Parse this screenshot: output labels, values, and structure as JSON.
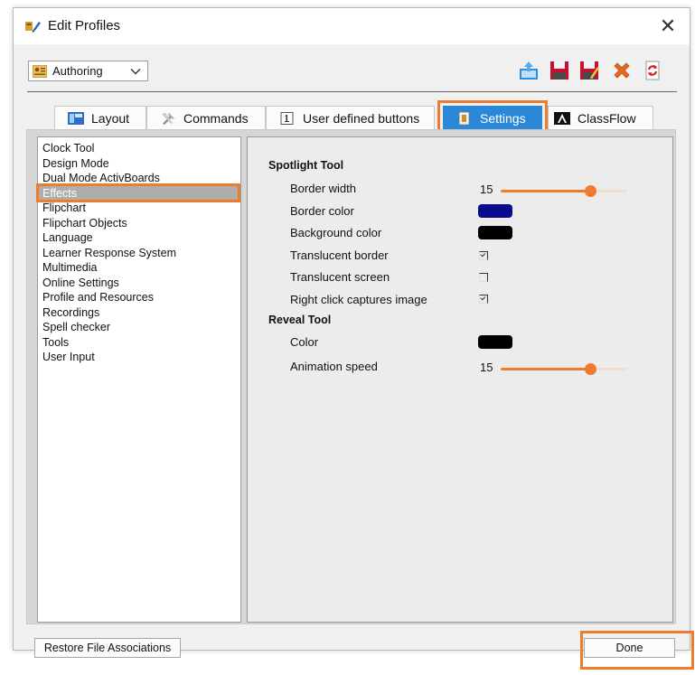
{
  "window": {
    "title": "Edit Profiles",
    "close_glyph": "✕"
  },
  "profile_select": {
    "value": "Authoring"
  },
  "toolbar": {
    "buttons": [
      {
        "name": "export-icon",
        "color": "#2d8fe0"
      },
      {
        "name": "save-icon",
        "color": "#c8102e"
      },
      {
        "name": "save-as-icon",
        "color": "#c8102e"
      },
      {
        "name": "delete-icon",
        "color": "#e46a1f"
      },
      {
        "name": "refresh-icon",
        "color": "#d42020"
      }
    ]
  },
  "tabs": [
    {
      "label": "Layout"
    },
    {
      "label": "Commands"
    },
    {
      "label": "User defined buttons"
    },
    {
      "label": "Settings",
      "selected": true
    },
    {
      "label": "ClassFlow"
    }
  ],
  "categories": [
    "Clock Tool",
    "Design Mode",
    "Dual Mode ActivBoards",
    "Effects",
    "Flipchart",
    "Flipchart Objects",
    "Language",
    "Learner Response System",
    "Multimedia",
    "Online Settings",
    "Profile and Resources",
    "Recordings",
    "Spell checker",
    "Tools",
    "User Input"
  ],
  "selected_category": "Effects",
  "settings": {
    "spotlight": {
      "heading": "Spotlight Tool",
      "border_width_label": "Border width",
      "border_width_value": "15",
      "border_width_fraction": 0.73,
      "border_color_label": "Border color",
      "border_color": "#0a0a8c",
      "background_color_label": "Background color",
      "background_color": "#000000",
      "translucent_border_label": "Translucent border",
      "translucent_border_checked": true,
      "translucent_screen_label": "Translucent screen",
      "translucent_screen_checked": false,
      "right_click_label": "Right click captures image",
      "right_click_checked": true
    },
    "reveal": {
      "heading": "Reveal Tool",
      "color_label": "Color",
      "color": "#000000",
      "animation_speed_label": "Animation speed",
      "animation_speed_value": "15",
      "animation_speed_fraction": 0.73
    }
  },
  "footer": {
    "restore_label": "Restore File Associations",
    "done_label": "Done"
  },
  "accent_color": "#ef7c2e",
  "selection_color": "#2b87d8"
}
